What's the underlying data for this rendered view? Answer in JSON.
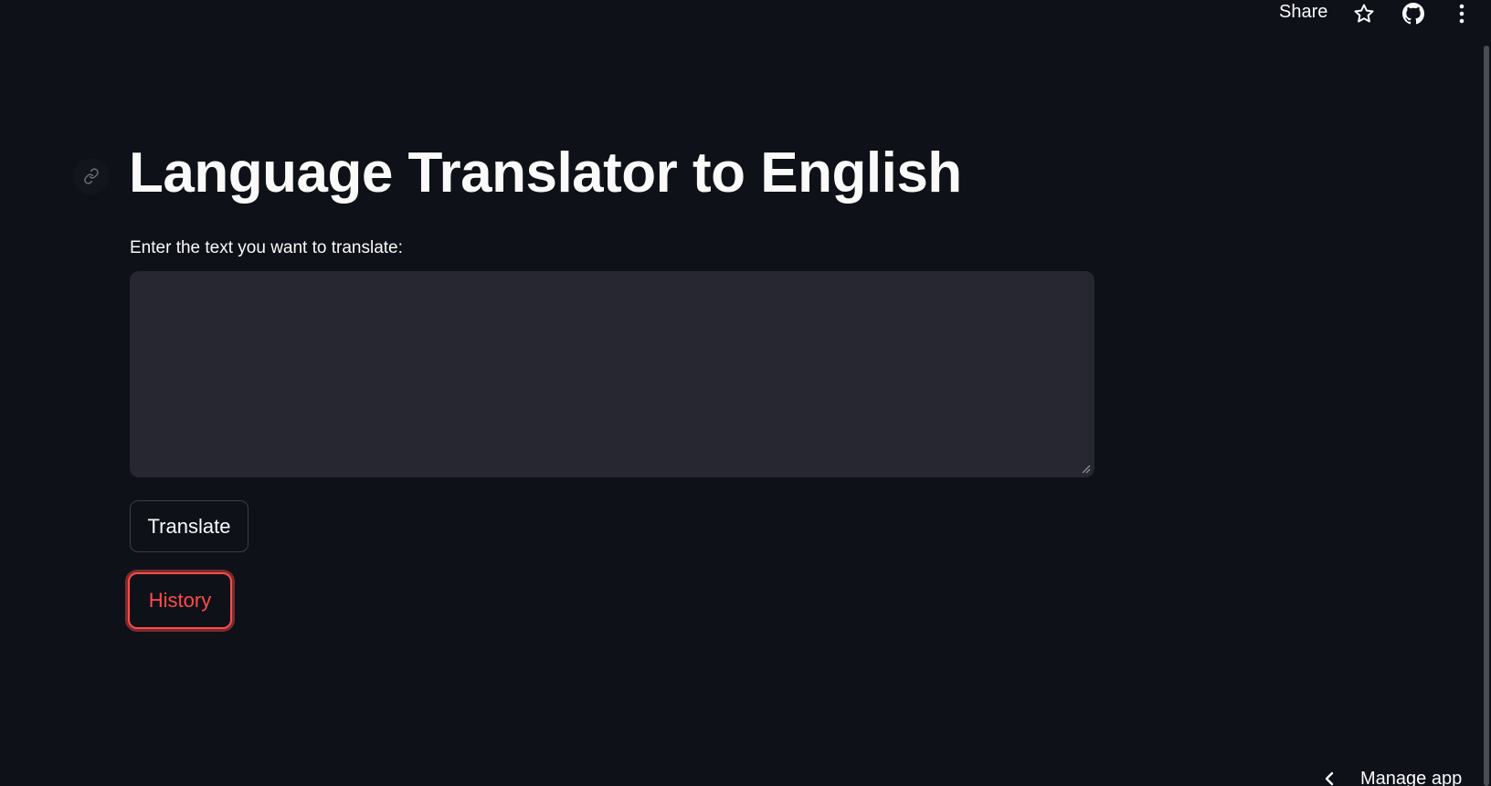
{
  "header": {
    "share_label": "Share",
    "star_icon": "star-icon",
    "github_icon": "github-icon",
    "menu_icon": "more-vertical-icon"
  },
  "main": {
    "anchor_icon": "link-icon",
    "title": "Language Translator to English",
    "input_label": "Enter the text you want to translate:",
    "input_value": "",
    "input_placeholder": "",
    "translate_label": "Translate",
    "history_label": "History"
  },
  "footer": {
    "manage_app_label": "Manage app",
    "chevron_icon": "chevron-left-icon"
  },
  "colors": {
    "background": "#0e1117",
    "text": "#fafafa",
    "input_bg": "#262730",
    "accent": "#ff4b4b"
  }
}
